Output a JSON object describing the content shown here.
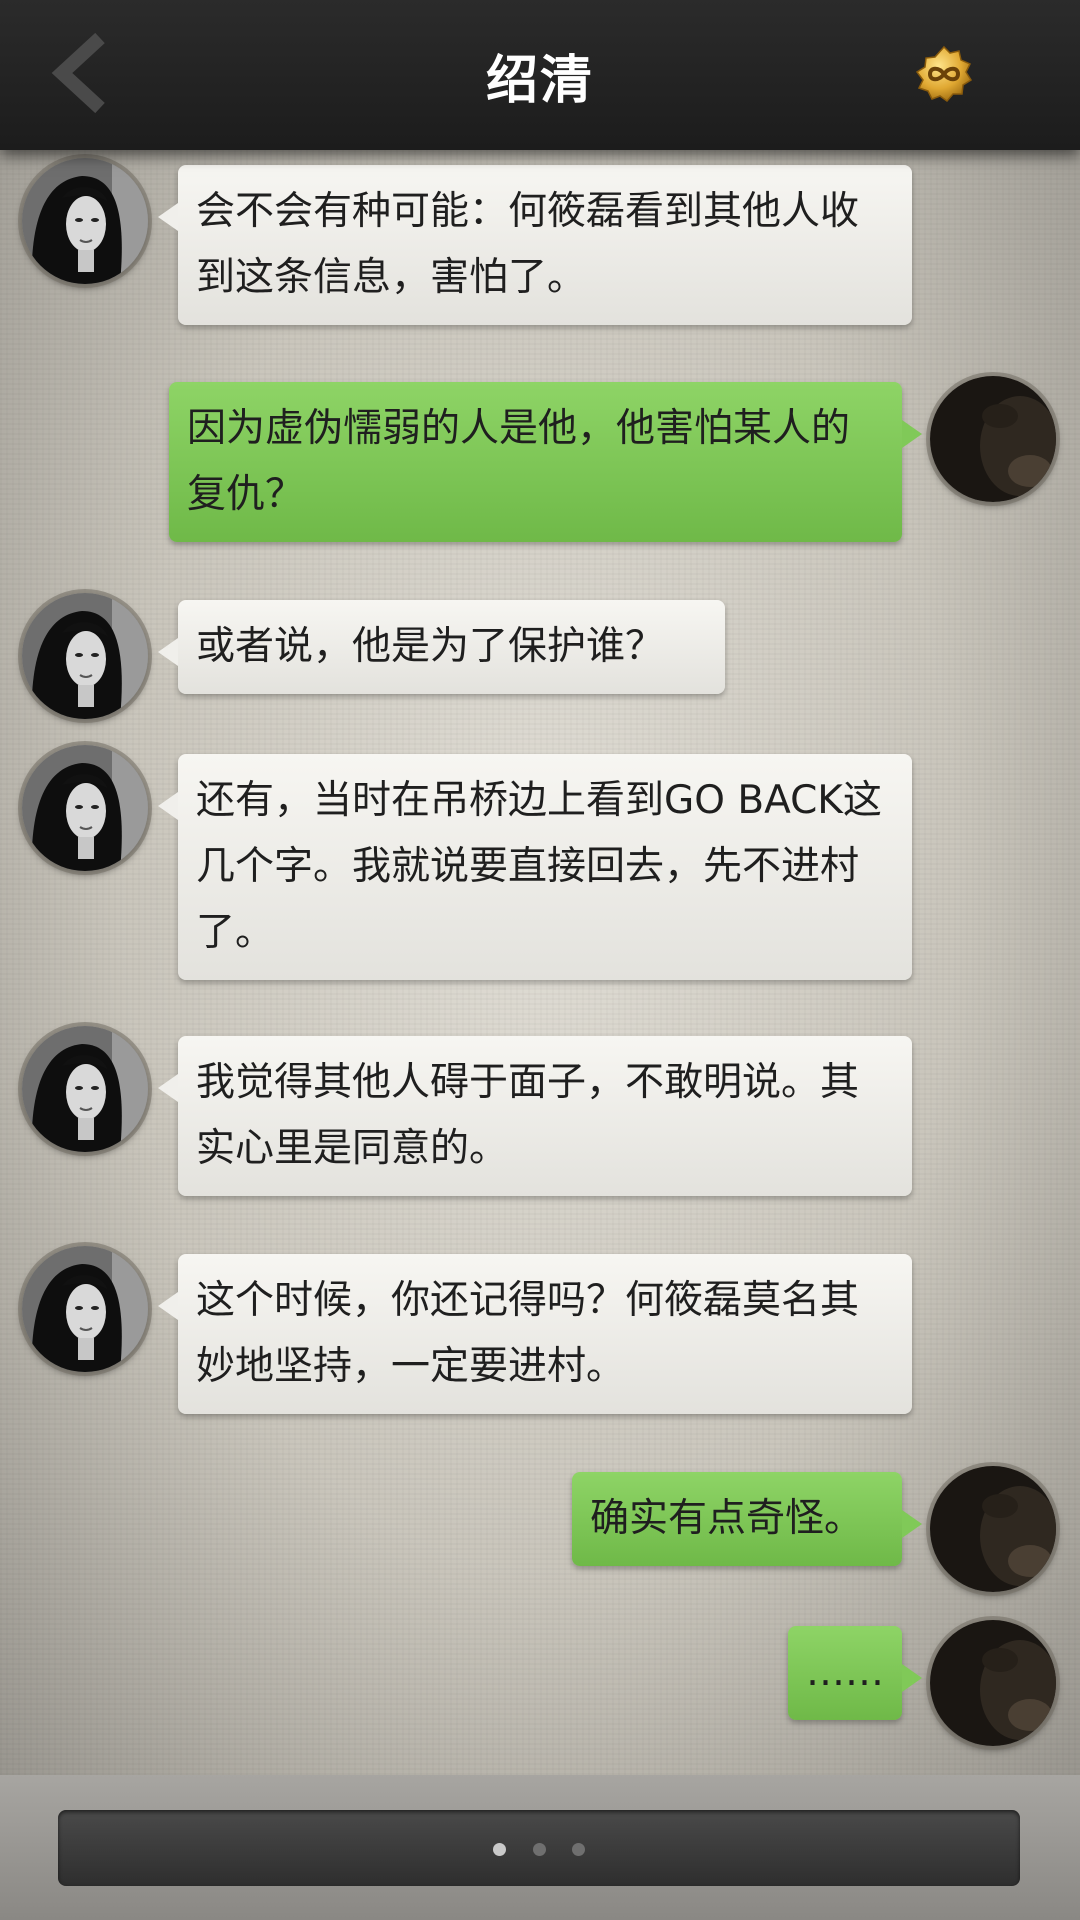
{
  "header": {
    "title": "绍清",
    "back_icon": "chevron-left-icon",
    "right_icon": "infinity-coin-icon"
  },
  "messages": [
    {
      "side": "left",
      "text": "会不会有种可能：何筱磊看到其他人收到这条信息，害怕了。"
    },
    {
      "side": "right",
      "text": "因为虚伪懦弱的人是他，他害怕某人的复仇？"
    },
    {
      "side": "left",
      "text": "或者说，他是为了保护谁？"
    },
    {
      "side": "left",
      "text": "还有，当时在吊桥边上看到GO BACK这几个字。我就说要直接回去，先不进村了。"
    },
    {
      "side": "left",
      "text": "我觉得其他人碍于面子，不敢明说。其实心里是同意的。"
    },
    {
      "side": "left",
      "text": "这个时候，你还记得吗？何筱磊莫名其妙地坚持，一定要进村。"
    },
    {
      "side": "right",
      "text": "确实有点奇怪。"
    },
    {
      "side": "right",
      "text": "……"
    }
  ],
  "footer": {
    "page_indicator": {
      "total": 3,
      "active": 1
    }
  },
  "colors": {
    "header_bg": "#222222",
    "left_bubble": "#efeeea",
    "right_bubble": "#7cc553",
    "text": "#1f1f1f"
  }
}
